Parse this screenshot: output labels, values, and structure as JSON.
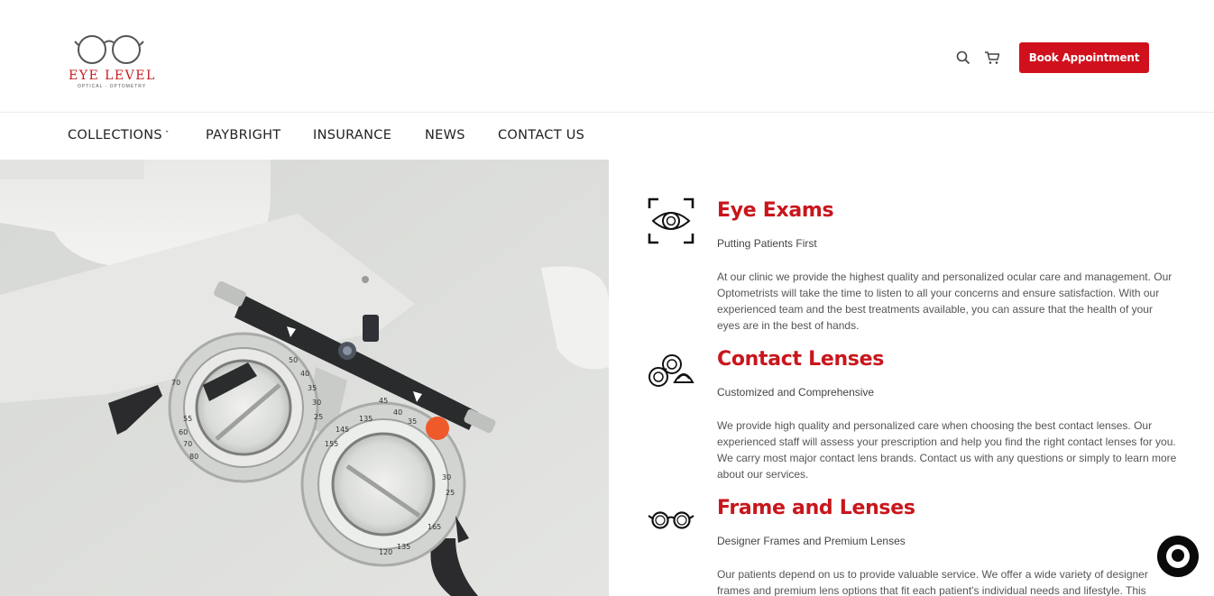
{
  "header": {
    "logo_text": "EYE  LEVEL",
    "logo_subtext": "OPTICAL · OPTOMETRY",
    "search_icon": "search-icon",
    "cart_icon": "cart-icon",
    "book_button_label": "Book Appointment"
  },
  "nav": {
    "items": [
      {
        "label": "COLLECTIONS",
        "has_dropdown": true
      },
      {
        "label": "PAYBRIGHT"
      },
      {
        "label": "INSURANCE"
      },
      {
        "label": "NEWS"
      },
      {
        "label": "CONTACT US"
      }
    ]
  },
  "colors": {
    "accent": "#d0101c",
    "title_red": "#c8161c"
  },
  "services": [
    {
      "icon": "eye-scan-icon",
      "title": "Eye Exams",
      "subtitle": "Putting Patients First",
      "body": "At our clinic we provide the highest quality and personalized ocular care and management. Our Optometrists will take the time to listen to all your concerns and ensure satisfaction. With our experienced team and the best treatments available, you can assure that the health of your eyes are in the best of hands."
    },
    {
      "icon": "contact-lens-case-icon",
      "title": "Contact Lenses",
      "subtitle": "Customized and Comprehensive",
      "body": "We provide high quality and personalized care when choosing the best contact lenses. Our experienced staff will assess your prescription and help you find the right contact lenses for you. We carry most major contact lens brands. Contact us with any questions or simply to learn more about our services."
    },
    {
      "icon": "eyeglasses-icon",
      "title": "Frame and Lenses",
      "subtitle": "Designer Frames and Premium Lenses",
      "body": "Our patients depend on us to provide valuable service. We offer a wide variety of designer frames and premium lens options that fit each patient's individual needs and lifestyle. This"
    }
  ],
  "hero": {
    "tick_labels": [
      "70",
      "50",
      "40",
      "35",
      "30",
      "25",
      "55",
      "60",
      "70",
      "80",
      "45",
      "40",
      "35",
      "30",
      "25",
      "135",
      "145",
      "155",
      "165",
      "120",
      "135"
    ]
  },
  "chat_icon": "chat-bubble-icon"
}
